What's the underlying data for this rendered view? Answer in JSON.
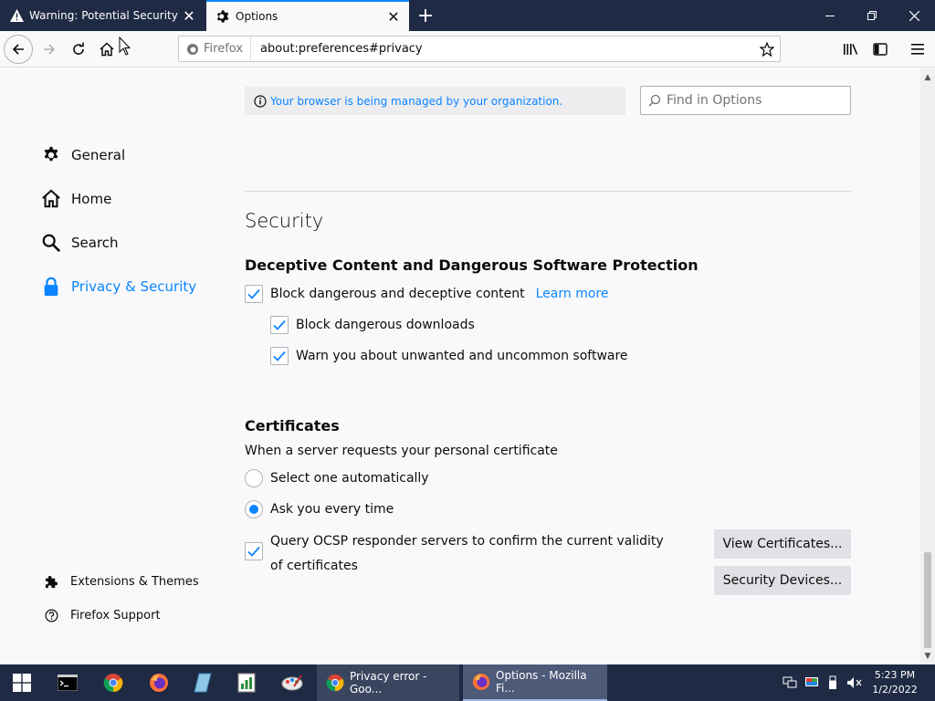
{
  "tabs": [
    {
      "label": "Warning: Potential Security Risk Ahead",
      "icon": "warning-icon",
      "active": false
    },
    {
      "label": "Options",
      "icon": "gear-icon",
      "active": true
    }
  ],
  "window": {
    "accent": "#0a84ff",
    "frame_color": "#1f2a44"
  },
  "url": {
    "identity_label": "Firefox",
    "address": "about:preferences#privacy"
  },
  "policy_notice": "Your browser is being managed by your organization.",
  "find": {
    "placeholder": "Find in Options"
  },
  "sidebar": {
    "categories": [
      {
        "label": "General",
        "icon": "gear-icon",
        "selected": false
      },
      {
        "label": "Home",
        "icon": "home-icon",
        "selected": false
      },
      {
        "label": "Search",
        "icon": "search-icon",
        "selected": false
      },
      {
        "label": "Privacy & Security",
        "icon": "lock-icon",
        "selected": true
      }
    ],
    "footer": [
      {
        "label": "Extensions & Themes",
        "icon": "puzzle-icon"
      },
      {
        "label": "Firefox Support",
        "icon": "help-icon"
      }
    ]
  },
  "security": {
    "title": "Security",
    "deceptive": {
      "heading": "Deceptive Content and Dangerous Software Protection",
      "block_content": "Block dangerous and deceptive content",
      "learn_more": "Learn more",
      "block_downloads": "Block dangerous downloads",
      "warn_unwanted": "Warn you about unwanted and uncommon software"
    },
    "certificates": {
      "heading": "Certificates",
      "description": "When a server requests your personal certificate",
      "select_auto": "Select one automatically",
      "ask_every_time": "Ask you every time",
      "ocsp": "Query OCSP responder servers to confirm the current validity of certificates",
      "view_certificates": "View Certificates...",
      "security_devices": "Security Devices..."
    }
  },
  "taskbar": {
    "windows": [
      {
        "label": "Privacy error - Goo...",
        "icon": "chrome-icon"
      },
      {
        "label": "Options - Mozilla Fi...",
        "icon": "firefox-icon"
      }
    ],
    "clock": {
      "time": "5:23 PM",
      "date": "1/2/2022"
    }
  }
}
